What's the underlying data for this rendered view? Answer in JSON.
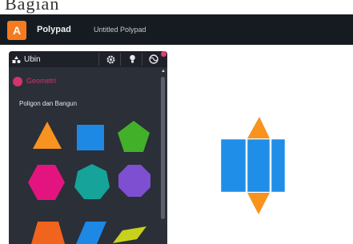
{
  "top_fragment": {
    "text": "Bagian"
  },
  "app": {
    "name": "Polypad",
    "logo": "A",
    "document_title": "Untitled Polypad"
  },
  "panel": {
    "tab_label": "Ubin",
    "section_label": "Geometri",
    "group_label": "Poligon dan Bangun",
    "icons": [
      "shapes-icon",
      "gear-icon",
      "bulb-icon",
      "globe-icon"
    ]
  },
  "tiles": [
    {
      "name": "triangle-tile",
      "color": "#f7931e"
    },
    {
      "name": "square-tile",
      "color": "#1e88e5"
    },
    {
      "name": "pentagon-tile",
      "color": "#43b02a"
    },
    {
      "name": "hexagon-tile",
      "color": "#e3147f"
    },
    {
      "name": "heptagon-tile",
      "color": "#15a39a"
    },
    {
      "name": "octagon-tile",
      "color": "#7e4fd0"
    },
    {
      "name": "trapezoid-tile",
      "color": "#f0641e"
    },
    {
      "name": "rhombus-tile",
      "color": "#1e88e5"
    },
    {
      "name": "parallelogram-tile",
      "color": "#c8d21c"
    }
  ],
  "canvas": {
    "net_colors": {
      "rect": "#1e8ee8",
      "triangle": "#f7931e"
    }
  },
  "colors": {
    "titlebar": "#161b22",
    "panel": "#2b2f38",
    "accent": "#d6336c"
  }
}
